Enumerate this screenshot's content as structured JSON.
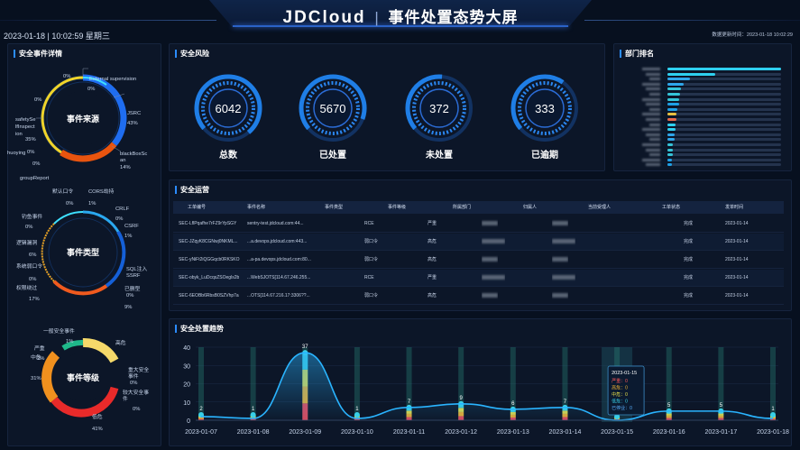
{
  "header": {
    "brand": "JDCloud",
    "separator": "|",
    "title": "事件处置态势大屏",
    "datetime": "2023-01-18 | 10:02:59 星期三",
    "updated": "数据更新时间：2023-01-18 10:02:29"
  },
  "panels": {
    "event_details": "安全事件详情",
    "risk": "安全风险",
    "dept_rank": "部门排名",
    "operations": "安全运营",
    "trend": "安全处置趋势"
  },
  "source_chart": {
    "center": "事件来源",
    "labels": [
      {
        "text": "0%"
      },
      {
        "text": "External supervision"
      },
      {
        "text": "0%"
      },
      {
        "text": "JSRC"
      },
      {
        "text": "43%"
      },
      {
        "text": "0%"
      },
      {
        "text": "safetySelfInspection"
      },
      {
        "text": "35%"
      },
      {
        "text": "huoying"
      },
      {
        "text": "0%"
      },
      {
        "text": "blackBoxScan"
      },
      {
        "text": "14%"
      },
      {
        "text": "groupReport"
      },
      {
        "text": "0%"
      }
    ]
  },
  "type_chart": {
    "center": "事件类型",
    "labels": [
      {
        "text": "默认口令"
      },
      {
        "text": "0%"
      },
      {
        "text": "CORS劫持"
      },
      {
        "text": "1%"
      },
      {
        "text": "CRLF"
      },
      {
        "text": "0%"
      },
      {
        "text": "CSRF"
      },
      {
        "text": "1%"
      },
      {
        "text": "钓鱼事件"
      },
      {
        "text": "0%"
      },
      {
        "text": "逻辑漏洞"
      },
      {
        "text": "6%"
      },
      {
        "text": "SQL注入"
      },
      {
        "text": "SSRF"
      },
      {
        "text": "系统弱口令"
      },
      {
        "text": "0%"
      },
      {
        "text": "已删型"
      },
      {
        "text": "0%"
      },
      {
        "text": "权限绕过"
      },
      {
        "text": "17%"
      },
      {
        "text": "9%"
      }
    ]
  },
  "level_chart": {
    "center": "事件等级",
    "labels": [
      {
        "text": "一般安全事件"
      },
      {
        "text": "1%"
      },
      {
        "text": "严重"
      },
      {
        "text": "高危"
      },
      {
        "text": "中危"
      },
      {
        "text": "2%"
      },
      {
        "text": "31%"
      },
      {
        "text": "重大安全事件"
      },
      {
        "text": "0%"
      },
      {
        "text": "较大安全事件"
      },
      {
        "text": "0%"
      },
      {
        "text": "低危"
      },
      {
        "text": "41%"
      }
    ]
  },
  "gauges": [
    {
      "value": "6042",
      "label": "总数",
      "level": 0.9
    },
    {
      "value": "5670",
      "label": "已处置",
      "level": 0.8
    },
    {
      "value": "372",
      "label": "未处置",
      "level": 0.45
    },
    {
      "value": "333",
      "label": "已逾期",
      "level": 0.55
    }
  ],
  "dept_rank": {
    "fill_colors": [
      "#2fd0f0",
      "#2fd0f0",
      "#2fa6ea",
      "#2fa6ea",
      "#35c4d8",
      "#35c4d8",
      "#35c4d8",
      "#1ea0e6",
      "#1ea0e6",
      "#e8c040",
      "#e86a4a",
      "#2fd0f0",
      "#2fd0f0",
      "#2fa6ea",
      "#2fa6ea",
      "#35c4d8",
      "#35c4d8",
      "#35c4d8",
      "#1ea0e6",
      "#1ea0e6"
    ],
    "levels": [
      1.0,
      0.42,
      0.2,
      0.14,
      0.12,
      0.11,
      0.1,
      0.1,
      0.09,
      0.08,
      0.08,
      0.07,
      0.07,
      0.06,
      0.06,
      0.05,
      0.05,
      0.05,
      0.04,
      0.04
    ]
  },
  "table": {
    "columns": [
      "工单编号",
      "事件名称",
      "事件类型",
      "事件等级",
      "所属部门",
      "归属人",
      "当前受理人",
      "工单状态",
      "发单时间"
    ],
    "rows": [
      {
        "id": "SEC-LflPqafhe7rFZ9rYpSGY",
        "name": "sentry-test.jdcloud.com:44...",
        "type": "RCE",
        "level": "严重",
        "status": "完成",
        "time": "2023-01-14"
      },
      {
        "id": "SEC-JZqyK8CGNwj0NKML...",
        "name": "...a.devops.jdcloud.com:443...",
        "type": "弱口令",
        "level": "高危",
        "status": "完成",
        "time": "2023-01-14"
      },
      {
        "id": "SEC-yNiFt2iQGGqcb0RKSKO",
        "name": "...a-pa.devops.jdcloud.com:80...",
        "type": "弱口令",
        "level": "高危",
        "status": "完成",
        "time": "2023-01-14"
      },
      {
        "id": "SEC-obyk_LuDcqsZSOegls2b",
        "name": "...WebSJOTS[114.67.246.255...",
        "type": "RCE",
        "level": "严重",
        "status": "完成",
        "time": "2023-01-14"
      },
      {
        "id": "SEC-6EOBb6RbsB0SZVhp7a",
        "name": "...OTS[114.67.216.17:3306??...",
        "type": "弱口令",
        "level": "高危",
        "status": "完成",
        "time": "2023-01-14"
      }
    ]
  },
  "chart_data": {
    "type": "line",
    "title": "",
    "xlabel": "",
    "ylabel": "",
    "ylim": [
      0,
      40
    ],
    "yticks": [
      0,
      10,
      20,
      30,
      40
    ],
    "categories": [
      "2023-01-07",
      "2023-01-08",
      "2023-01-09",
      "2023-01-10",
      "2023-01-11",
      "2023-01-12",
      "2023-01-13",
      "2023-01-14",
      "2023-01-15",
      "2023-01-16",
      "2023-01-17",
      "2023-01-18"
    ],
    "values": [
      2,
      1,
      37,
      1,
      7,
      9,
      6,
      7,
      0,
      5,
      5,
      1
    ],
    "point_labels": [
      "2",
      "1",
      "37",
      "1",
      "7",
      "9",
      "6",
      "7",
      "",
      "5",
      "5",
      "1"
    ],
    "tooltip": {
      "date": "2023-01-15",
      "rows": [
        "严重：0",
        "高危：0",
        "中危：0",
        "低危：0",
        "已停业：0"
      ]
    },
    "colors": {
      "line": "#2ab4ff",
      "segments": [
        "#e84a5f",
        "#f2b233",
        "#e8e04a",
        "#38d0e8"
      ]
    }
  }
}
